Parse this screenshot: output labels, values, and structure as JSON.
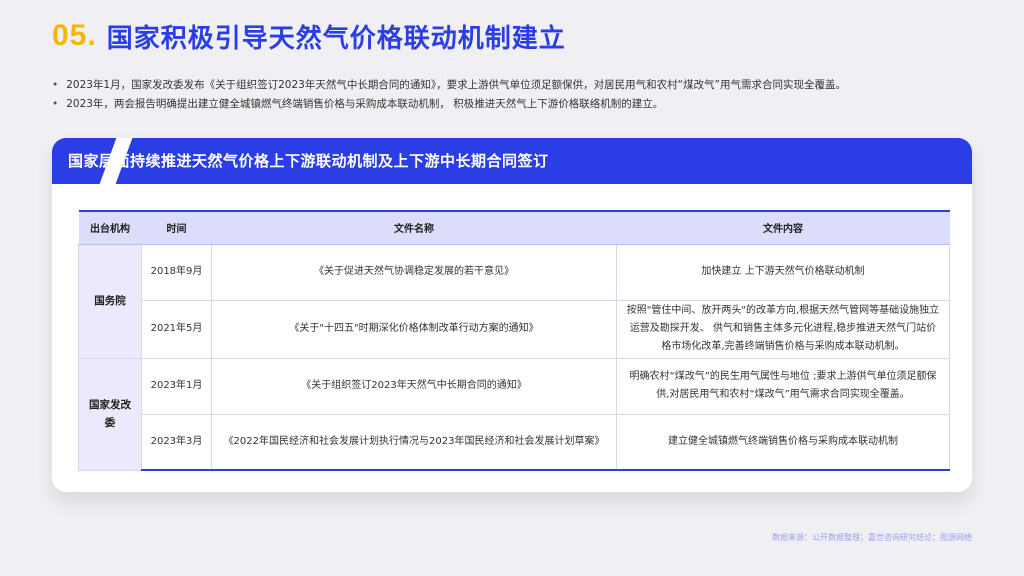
{
  "header": {
    "number": "05.",
    "title": "国家积极引导天然气价格联动机制建立"
  },
  "bullets": [
    "2023年1月，国家发改委发布《关于组织签订2023年天然气中长期合同的通知》，要求上游供气单位须足额保供，对居民用气和农村“煤改气”用气需求合同实现全覆盖。",
    "2023年，两会报告明确提出建立健全城镇燃气终端销售价格与采购成本联动机制， 积极推进天然气上下游价格联络机制的建立。"
  ],
  "card": {
    "banner": "国家层面持续推进天然气价格上下游联动机制及上下游中长期合同签订"
  },
  "table": {
    "headers": [
      "出台机构",
      "时间",
      "文件名称",
      "文件内容"
    ],
    "groups": [
      {
        "org": "国务院",
        "rows": [
          {
            "time": "2018年9月",
            "name": "《关于促进天然气协调稳定发展的若干意见》",
            "content": "加快建立 上下游天然气价格联动机制"
          },
          {
            "time": "2021年5月",
            "name": "《关于\"十四五\"时期深化价格体制改革行动方案的通知》",
            "content": "按照\"管住中间、放开两头\"的改革方向,根据天然气管网等基础设施独立运营及勘探开发、 供气和销售主体多元化进程,稳步推进天然气门站价格市场化改革,完善终端销售价格与采购成本联动机制。"
          }
        ]
      },
      {
        "org": "国家发改委",
        "rows": [
          {
            "time": "2023年1月",
            "name": "《关于组织签订2023年天然气中长期合同的通知》",
            "content": "明确农村“煤改气”的民生用气属性与地位 ;要求上游供气单位须足额保供,对居民用气和农村“煤改气”用气需求合同实现全覆盖。"
          },
          {
            "time": "2023年3月",
            "name": "《2022年国民经济和社会发展计划执行情况与2023年国民经济和社会发展计划草案》",
            "content": "建立健全城镇燃气终端销售价格与采购成本联动机制"
          }
        ]
      }
    ]
  },
  "footer": {
    "source": "数据来源：公开数据整理；嘉世咨询研究结论；图源网络"
  }
}
